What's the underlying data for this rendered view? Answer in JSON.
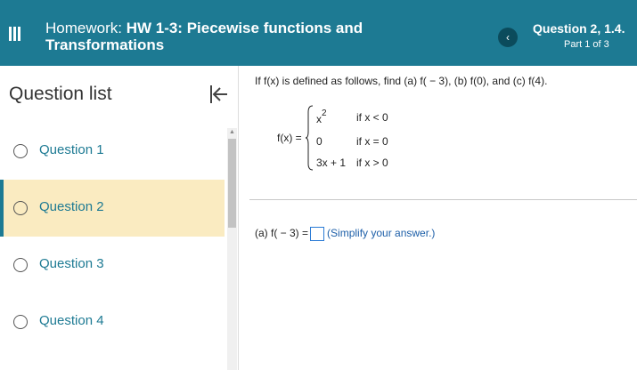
{
  "header": {
    "homework_prefix": "Homework: ",
    "homework_title": "HW 1-3: Piecewise functions and Transformations",
    "question_title": "Question 2, 1.4.",
    "part": "Part 1 of 3"
  },
  "icons": {
    "menu": "hamburger-menu-icon",
    "prev": "chevron-left-icon",
    "collapse": "collapse-left-icon"
  },
  "colors": {
    "header_bg": "#1d7a93",
    "active_item_bg": "#faebc1",
    "link": "#1d7a93",
    "hint": "#1d5fa8"
  },
  "sidebar": {
    "title": "Question list",
    "items": [
      {
        "label": "Question 1",
        "active": false
      },
      {
        "label": "Question 2",
        "active": true
      },
      {
        "label": "Question 3",
        "active": false
      },
      {
        "label": "Question 4",
        "active": false
      }
    ]
  },
  "question": {
    "prompt": "If f(x) is defined as follows, find (a) f( − 3), (b) f(0), and (c) f(4).",
    "function_label": "f(x) =",
    "pieces": [
      {
        "expr": "x",
        "exponent": "2",
        "condition": "if x < 0"
      },
      {
        "expr": "0",
        "condition": "if x = 0"
      },
      {
        "expr": "3x + 1",
        "condition": "if x > 0"
      }
    ]
  },
  "answer": {
    "label": "(a) f( − 3) =",
    "value": "",
    "hint": "(Simplify your answer.)"
  }
}
